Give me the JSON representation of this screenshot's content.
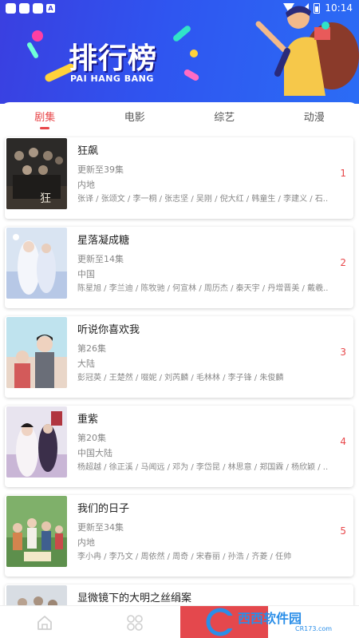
{
  "status_bar": {
    "time": "10:14",
    "badge": "A"
  },
  "banner": {
    "title": "排行榜",
    "subtitle": "PAI HANG BANG"
  },
  "tabs": [
    {
      "label": "剧集",
      "active": true
    },
    {
      "label": "电影",
      "active": false
    },
    {
      "label": "综艺",
      "active": false
    },
    {
      "label": "动漫",
      "active": false
    }
  ],
  "accent_color": "#e8474a",
  "items": [
    {
      "title": "狂飙",
      "update": "更新至39集",
      "region": "内地",
      "cast": "张译 / 张颂文 / 李一桐 / 张志坚 / 吴刚 / 倪大红 / 韩童生 / 李建义 / 石...",
      "rank": "1",
      "poster": "poster-dark-drama"
    },
    {
      "title": "星落凝成糖",
      "update": "更新至14集",
      "region": "中国",
      "cast": "陈星旭 / 李兰迪 / 陈牧驰 / 何宣林 / 周历杰 / 秦天宇 / 丹增晋美 / 戴羲...",
      "rank": "2",
      "poster": "poster-white-fantasy"
    },
    {
      "title": "听说你喜欢我",
      "update": "第26集",
      "region": "大陆",
      "cast": "彭冠英 / 王楚然 / 啜妮 / 刘芮麟 / 毛林林 / 李子锋 / 朱俊麟",
      "rank": "3",
      "poster": "poster-light-romance"
    },
    {
      "title": "重紫",
      "update": "第20集",
      "region": "中国大陆",
      "cast": "杨超越 / 徐正溪 / 马闻远 / 邓为 / 李岱昆 / 林思意 / 郑国霖 / 杨欣颖 / ...",
      "rank": "4",
      "poster": "poster-costume-fantasy"
    },
    {
      "title": "我们的日子",
      "update": "更新至34集",
      "region": "内地",
      "cast": "李小冉 / 李乃文 / 周依然 / 周奇 / 宋春丽 / 孙浩 / 齐菱 / 任帅",
      "rank": "5",
      "poster": "poster-family-green"
    },
    {
      "title": "显微镜下的大明之丝绢案",
      "update": "",
      "region": "",
      "cast": "",
      "rank": "",
      "poster": "poster-period"
    }
  ],
  "bottom_nav": [
    {
      "name": "home",
      "icon": "home-icon"
    },
    {
      "name": "discover",
      "icon": "grid-icon"
    }
  ],
  "watermark": {
    "text": "西西软件园",
    "sub": "CR173.com"
  }
}
